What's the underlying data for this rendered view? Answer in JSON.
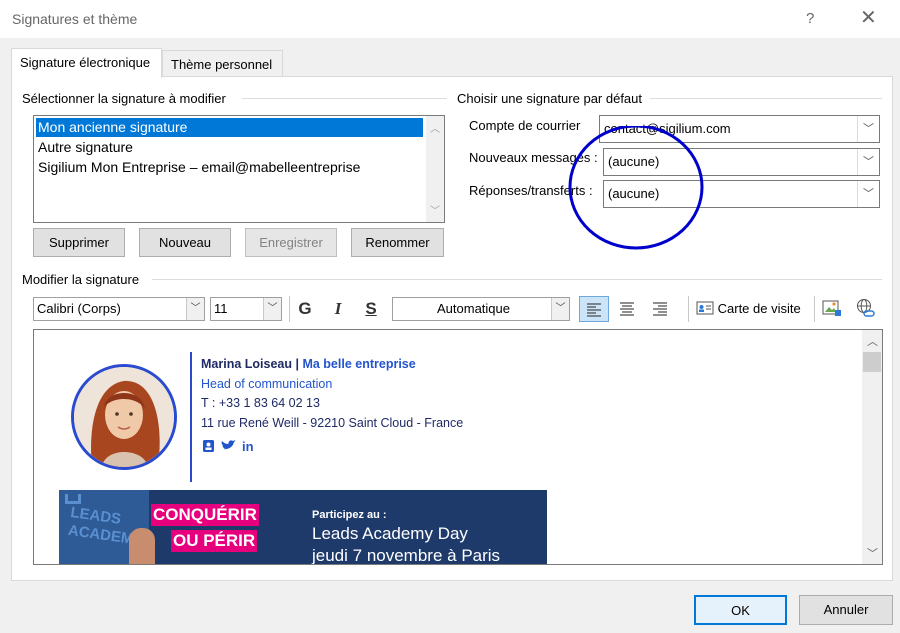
{
  "window": {
    "title": "Signatures et thème",
    "help": "?",
    "close": "✕"
  },
  "tabs": [
    {
      "label": "Signature électronique"
    },
    {
      "label": "Thème personnel"
    }
  ],
  "select_section": {
    "header": "Sélectionner la signature à modifier",
    "items": [
      "Mon ancienne signature",
      "Autre signature",
      "Sigilium  Mon Entreprise  –  email@mabelleentreprise"
    ],
    "selected_index": 0,
    "buttons": {
      "delete": "Supprimer",
      "new": "Nouveau",
      "save": "Enregistrer",
      "rename": "Renommer"
    }
  },
  "default_section": {
    "header": "Choisir une signature par défaut",
    "account_label": "Compte de courrier",
    "account_value": "contact@sigilium.com",
    "new_messages_label": "Nouveaux messages :",
    "new_messages_value": "(aucune)",
    "replies_label": "Réponses/transferts :",
    "replies_value": "(aucune)"
  },
  "edit_section": {
    "header": "Modifier la signature",
    "font": "Calibri (Corps)",
    "size": "11",
    "bold": "G",
    "italic": "I",
    "underline": "S",
    "color": "Automatique",
    "business_card": "Carte de visite"
  },
  "signature": {
    "name": "Marina Loiseau",
    "separator": " | ",
    "company": "Ma belle entreprise",
    "role": "Head of communication",
    "phone": "T : +33 1 83 64 02 13",
    "address": "11 rue René Weill - 92210 Saint Cloud - France",
    "social_icons": [
      "contact-icon",
      "twitter-icon",
      "linkedin-icon"
    ]
  },
  "banner": {
    "brand": "LEADS ACADEMY",
    "headline1": "CONQUÉRIR",
    "headline2": "OU PÉRIR",
    "lead": "Participez au :",
    "event": "Leads Academy Day",
    "date": "jeudi 7 novembre à Paris"
  },
  "footer": {
    "ok": "OK",
    "cancel": "Annuler"
  },
  "colors": {
    "selection": "#0078d7",
    "annotation_circle": "#0000cc",
    "signature_text": "#1f2a66",
    "accent": "#2255cc",
    "banner_pink": "#e6007e"
  }
}
